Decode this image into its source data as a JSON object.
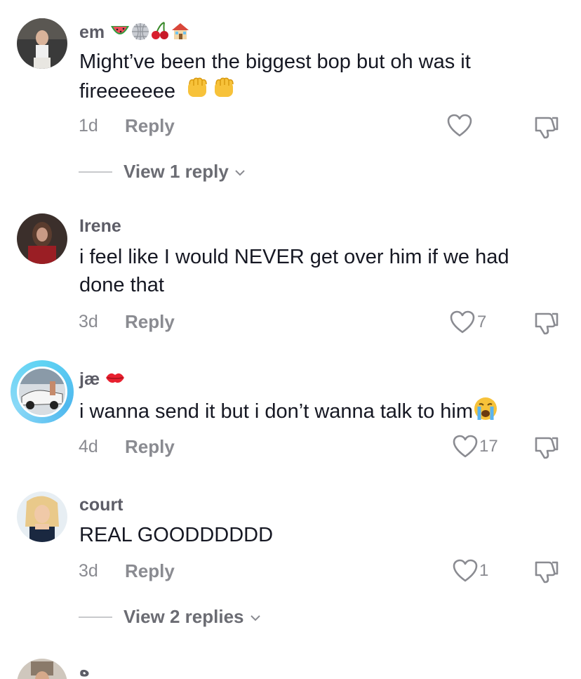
{
  "comments": [
    {
      "username": "em",
      "username_emojis": [
        "watermelon-icon",
        "disco-ball-icon",
        "cherries-icon",
        "house-icon"
      ],
      "text_line1": "Might’ve been the biggest bop but oh was it",
      "text_line2": "fireeeeeee",
      "text_emojis": [
        "raised-fist-icon",
        "raised-fist-icon"
      ],
      "age": "1d",
      "reply_label": "Reply",
      "likes": "",
      "view_replies": "View 1 reply"
    },
    {
      "username": "Irene",
      "text_line1": "i feel like I would NEVER get over him if we had",
      "text_line2": "done that",
      "age": "3d",
      "reply_label": "Reply",
      "likes": "7"
    },
    {
      "username": "jæ",
      "username_emojis": [
        "kiss-mark-icon"
      ],
      "text_line1": "i wanna send it but i don’t wanna talk to him",
      "text_emojis": [
        "loudly-crying-face-icon"
      ],
      "age": "4d",
      "reply_label": "Reply",
      "likes": "17"
    },
    {
      "username": "court",
      "text_line1": "REAL GOODDDDDD",
      "age": "3d",
      "reply_label": "Reply",
      "likes": "1",
      "view_replies": "View 2 replies"
    },
    {
      "username": "ه"
    }
  ],
  "colors": {
    "text": "#161823",
    "secondary": "#8a8b91",
    "story_ring": "#5fd3f3"
  }
}
